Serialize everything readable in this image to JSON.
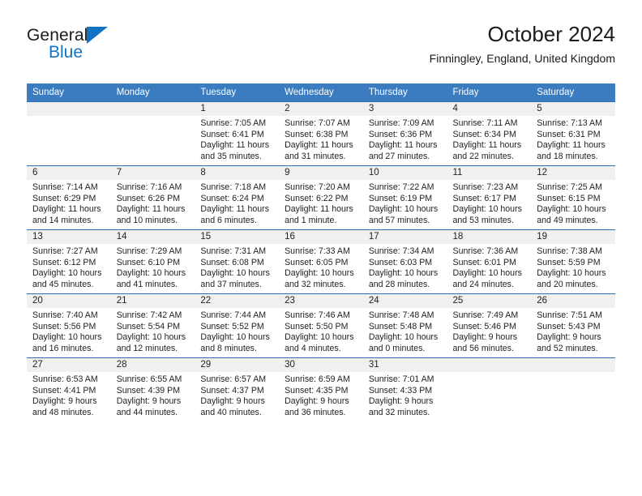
{
  "brand": {
    "line1": "General",
    "line2": "Blue",
    "triangle_color": "#1272c4",
    "logo_icon": "triangle-icon"
  },
  "header": {
    "title": "October 2024",
    "subtitle": "Finningley, England, United Kingdom"
  },
  "theme": {
    "header_bar_color": "#3b7cc0",
    "row_rule_color": "#2a6eb4",
    "daynum_band_color": "#f0f0f0",
    "text_color": "#222222"
  },
  "weekday_headers": [
    "Sunday",
    "Monday",
    "Tuesday",
    "Wednesday",
    "Thursday",
    "Friday",
    "Saturday"
  ],
  "labels": {
    "sunrise_prefix": "Sunrise:",
    "sunset_prefix": "Sunset:",
    "daylight_prefix": "Daylight:"
  },
  "weeks": [
    [
      {
        "day": "",
        "sunrise": "",
        "sunset": "",
        "daylight": ""
      },
      {
        "day": "",
        "sunrise": "",
        "sunset": "",
        "daylight": ""
      },
      {
        "day": "1",
        "sunrise": "Sunrise: 7:05 AM",
        "sunset": "Sunset: 6:41 PM",
        "daylight": "Daylight: 11 hours and 35 minutes."
      },
      {
        "day": "2",
        "sunrise": "Sunrise: 7:07 AM",
        "sunset": "Sunset: 6:38 PM",
        "daylight": "Daylight: 11 hours and 31 minutes."
      },
      {
        "day": "3",
        "sunrise": "Sunrise: 7:09 AM",
        "sunset": "Sunset: 6:36 PM",
        "daylight": "Daylight: 11 hours and 27 minutes."
      },
      {
        "day": "4",
        "sunrise": "Sunrise: 7:11 AM",
        "sunset": "Sunset: 6:34 PM",
        "daylight": "Daylight: 11 hours and 22 minutes."
      },
      {
        "day": "5",
        "sunrise": "Sunrise: 7:13 AM",
        "sunset": "Sunset: 6:31 PM",
        "daylight": "Daylight: 11 hours and 18 minutes."
      }
    ],
    [
      {
        "day": "6",
        "sunrise": "Sunrise: 7:14 AM",
        "sunset": "Sunset: 6:29 PM",
        "daylight": "Daylight: 11 hours and 14 minutes."
      },
      {
        "day": "7",
        "sunrise": "Sunrise: 7:16 AM",
        "sunset": "Sunset: 6:26 PM",
        "daylight": "Daylight: 11 hours and 10 minutes."
      },
      {
        "day": "8",
        "sunrise": "Sunrise: 7:18 AM",
        "sunset": "Sunset: 6:24 PM",
        "daylight": "Daylight: 11 hours and 6 minutes."
      },
      {
        "day": "9",
        "sunrise": "Sunrise: 7:20 AM",
        "sunset": "Sunset: 6:22 PM",
        "daylight": "Daylight: 11 hours and 1 minute."
      },
      {
        "day": "10",
        "sunrise": "Sunrise: 7:22 AM",
        "sunset": "Sunset: 6:19 PM",
        "daylight": "Daylight: 10 hours and 57 minutes."
      },
      {
        "day": "11",
        "sunrise": "Sunrise: 7:23 AM",
        "sunset": "Sunset: 6:17 PM",
        "daylight": "Daylight: 10 hours and 53 minutes."
      },
      {
        "day": "12",
        "sunrise": "Sunrise: 7:25 AM",
        "sunset": "Sunset: 6:15 PM",
        "daylight": "Daylight: 10 hours and 49 minutes."
      }
    ],
    [
      {
        "day": "13",
        "sunrise": "Sunrise: 7:27 AM",
        "sunset": "Sunset: 6:12 PM",
        "daylight": "Daylight: 10 hours and 45 minutes."
      },
      {
        "day": "14",
        "sunrise": "Sunrise: 7:29 AM",
        "sunset": "Sunset: 6:10 PM",
        "daylight": "Daylight: 10 hours and 41 minutes."
      },
      {
        "day": "15",
        "sunrise": "Sunrise: 7:31 AM",
        "sunset": "Sunset: 6:08 PM",
        "daylight": "Daylight: 10 hours and 37 minutes."
      },
      {
        "day": "16",
        "sunrise": "Sunrise: 7:33 AM",
        "sunset": "Sunset: 6:05 PM",
        "daylight": "Daylight: 10 hours and 32 minutes."
      },
      {
        "day": "17",
        "sunrise": "Sunrise: 7:34 AM",
        "sunset": "Sunset: 6:03 PM",
        "daylight": "Daylight: 10 hours and 28 minutes."
      },
      {
        "day": "18",
        "sunrise": "Sunrise: 7:36 AM",
        "sunset": "Sunset: 6:01 PM",
        "daylight": "Daylight: 10 hours and 24 minutes."
      },
      {
        "day": "19",
        "sunrise": "Sunrise: 7:38 AM",
        "sunset": "Sunset: 5:59 PM",
        "daylight": "Daylight: 10 hours and 20 minutes."
      }
    ],
    [
      {
        "day": "20",
        "sunrise": "Sunrise: 7:40 AM",
        "sunset": "Sunset: 5:56 PM",
        "daylight": "Daylight: 10 hours and 16 minutes."
      },
      {
        "day": "21",
        "sunrise": "Sunrise: 7:42 AM",
        "sunset": "Sunset: 5:54 PM",
        "daylight": "Daylight: 10 hours and 12 minutes."
      },
      {
        "day": "22",
        "sunrise": "Sunrise: 7:44 AM",
        "sunset": "Sunset: 5:52 PM",
        "daylight": "Daylight: 10 hours and 8 minutes."
      },
      {
        "day": "23",
        "sunrise": "Sunrise: 7:46 AM",
        "sunset": "Sunset: 5:50 PM",
        "daylight": "Daylight: 10 hours and 4 minutes."
      },
      {
        "day": "24",
        "sunrise": "Sunrise: 7:48 AM",
        "sunset": "Sunset: 5:48 PM",
        "daylight": "Daylight: 10 hours and 0 minutes."
      },
      {
        "day": "25",
        "sunrise": "Sunrise: 7:49 AM",
        "sunset": "Sunset: 5:46 PM",
        "daylight": "Daylight: 9 hours and 56 minutes."
      },
      {
        "day": "26",
        "sunrise": "Sunrise: 7:51 AM",
        "sunset": "Sunset: 5:43 PM",
        "daylight": "Daylight: 9 hours and 52 minutes."
      }
    ],
    [
      {
        "day": "27",
        "sunrise": "Sunrise: 6:53 AM",
        "sunset": "Sunset: 4:41 PM",
        "daylight": "Daylight: 9 hours and 48 minutes."
      },
      {
        "day": "28",
        "sunrise": "Sunrise: 6:55 AM",
        "sunset": "Sunset: 4:39 PM",
        "daylight": "Daylight: 9 hours and 44 minutes."
      },
      {
        "day": "29",
        "sunrise": "Sunrise: 6:57 AM",
        "sunset": "Sunset: 4:37 PM",
        "daylight": "Daylight: 9 hours and 40 minutes."
      },
      {
        "day": "30",
        "sunrise": "Sunrise: 6:59 AM",
        "sunset": "Sunset: 4:35 PM",
        "daylight": "Daylight: 9 hours and 36 minutes."
      },
      {
        "day": "31",
        "sunrise": "Sunrise: 7:01 AM",
        "sunset": "Sunset: 4:33 PM",
        "daylight": "Daylight: 9 hours and 32 minutes."
      },
      {
        "day": "",
        "sunrise": "",
        "sunset": "",
        "daylight": ""
      },
      {
        "day": "",
        "sunrise": "",
        "sunset": "",
        "daylight": ""
      }
    ]
  ]
}
